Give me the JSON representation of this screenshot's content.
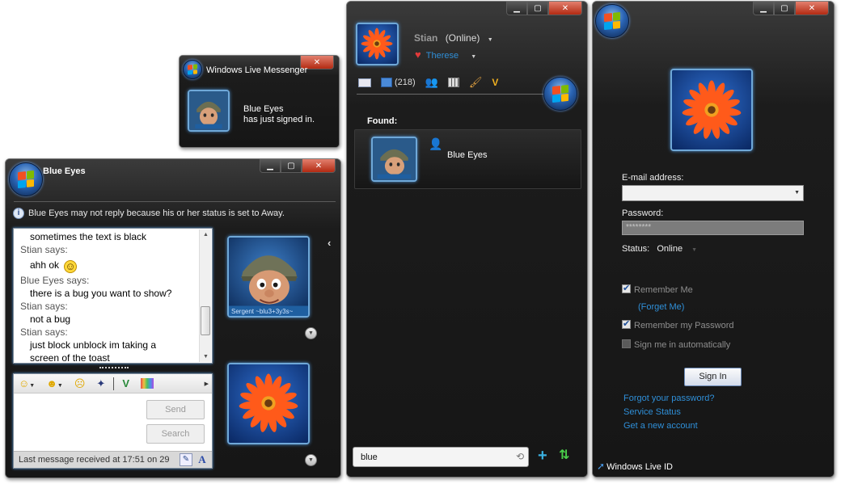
{
  "toast": {
    "title": "Windows Live Messenger",
    "line1": "Blue Eyes",
    "line2": "has just signed in.",
    "avatar_caption": "Sergent ~blu3+3y3s~"
  },
  "chat": {
    "title": "Blue Eyes",
    "info": "Blue Eyes may not reply because his or her status is set to Away.",
    "messages": [
      {
        "type": "msg",
        "text": "sometimes the text is black"
      },
      {
        "type": "says",
        "text": "Stian says:"
      },
      {
        "type": "msg",
        "text": "ahh ok",
        "emoticon": "smile-emoticon"
      },
      {
        "type": "says",
        "text": "Blue Eyes says:"
      },
      {
        "type": "msg",
        "text": "there is a bug you want to show?"
      },
      {
        "type": "says",
        "text": "Stian says:"
      },
      {
        "type": "msg",
        "text": "not a bug"
      },
      {
        "type": "says",
        "text": "Stian says:"
      },
      {
        "type": "msg",
        "text": "just block unblock im taking a"
      },
      {
        "type": "msg",
        "text": "screen of the toast"
      }
    ],
    "send_label": "Send",
    "search_label": "Search",
    "status_bar": "Last message received at 17:51 on 29",
    "contact_avatar_caption": "Sergent ~blu3+3y3s~",
    "toolbar_icons": [
      "emoticon-icon",
      "wink-icon",
      "nudge-icon",
      "voice-clip-icon",
      "ink-icon",
      "background-icon"
    ]
  },
  "contact_list": {
    "user_name": "Stian",
    "user_status": "(Online)",
    "partner_name": "Therese",
    "mail_count": "(218)",
    "found_label": "Found:",
    "found_contact": "Blue Eyes",
    "search_value": "blue",
    "toolbar_icons": [
      "mail-icon",
      "inbox-icon",
      "contacts-icon",
      "calendar-icon",
      "paint-icon",
      "live-icon"
    ]
  },
  "signin": {
    "email_label": "E-mail address:",
    "email_value": "",
    "password_label": "Password:",
    "password_value": "********",
    "status_label": "Status:",
    "status_value": "Online",
    "remember_me": "Remember Me",
    "forget_me": "(Forget Me)",
    "remember_password": "Remember my Password",
    "sign_in_auto": "Sign me in automatically",
    "signin_button": "Sign In",
    "forgot_password": "Forgot your password?",
    "service_status": "Service Status",
    "new_account": "Get a new account",
    "footer": "Windows Live ID"
  },
  "colors": {
    "window_bg": "#1a1a1a",
    "accent_link": "#2f8fd8",
    "close_button": "#c83a20",
    "avatar_border": "#6fa8d8"
  }
}
